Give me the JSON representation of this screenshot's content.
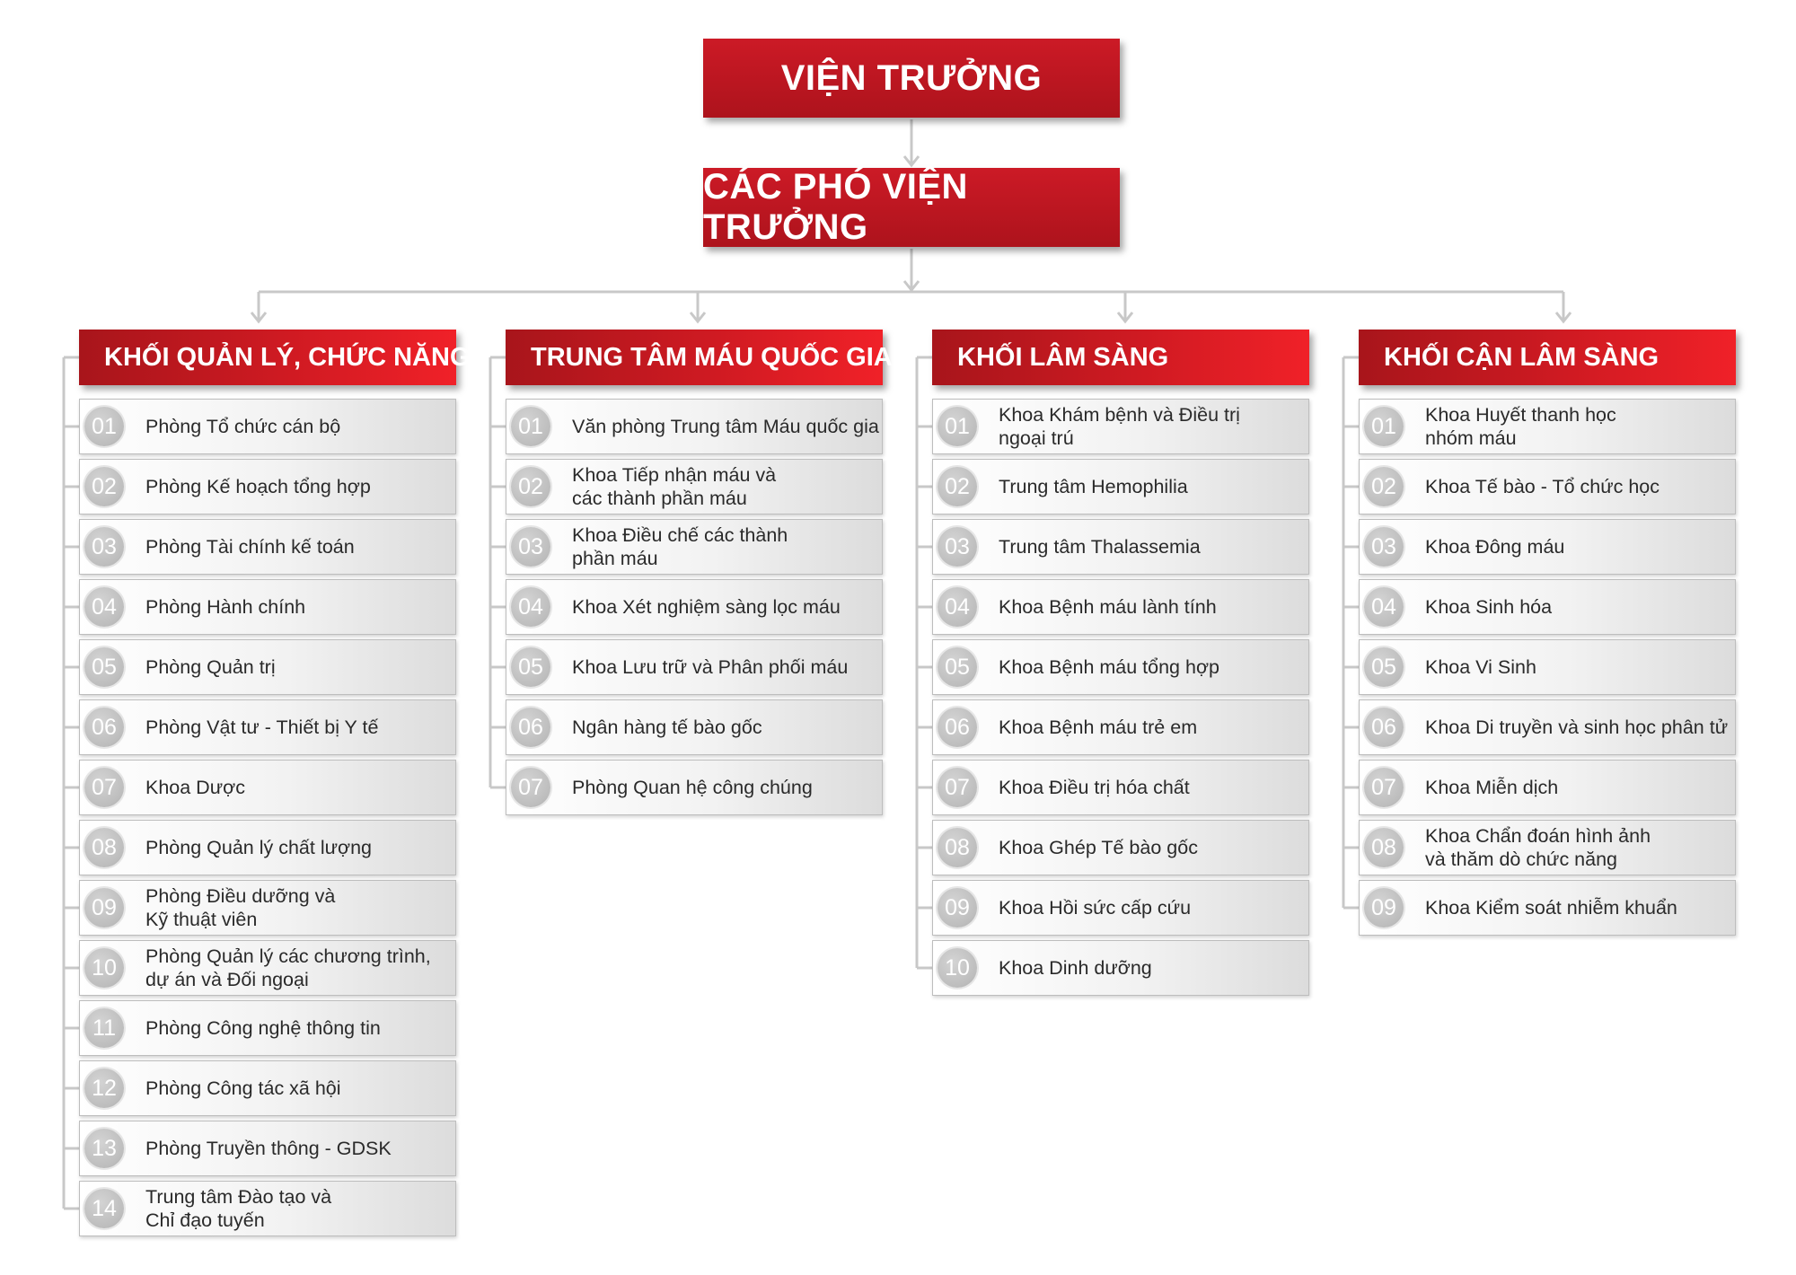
{
  "director": "VIỆN TRƯỞNG",
  "deputy_directors": "CÁC PHÓ VIỆN TRƯỞNG",
  "columns": [
    {
      "title": "KHỐI QUẢN LÝ, CHỨC NĂNG",
      "items": [
        {
          "num": "01",
          "label": "Phòng Tổ chức cán bộ"
        },
        {
          "num": "02",
          "label": "Phòng Kế hoạch tổng hợp"
        },
        {
          "num": "03",
          "label": "Phòng Tài chính kế toán"
        },
        {
          "num": "04",
          "label": "Phòng Hành chính"
        },
        {
          "num": "05",
          "label": "Phòng Quản trị"
        },
        {
          "num": "06",
          "label": "Phòng Vật tư - Thiết bị Y tế"
        },
        {
          "num": "07",
          "label": "Khoa Dược"
        },
        {
          "num": "08",
          "label": "Phòng Quản lý chất lượng"
        },
        {
          "num": "09",
          "label": "Phòng Điều dưỡng và\nKỹ thuật viên"
        },
        {
          "num": "10",
          "label": "Phòng Quản lý các chương trình,\ndự án và Đối ngoại"
        },
        {
          "num": "11",
          "label": "Phòng Công nghệ thông tin"
        },
        {
          "num": "12",
          "label": "Phòng Công tác xã hội"
        },
        {
          "num": "13",
          "label": "Phòng Truyền thông - GDSK"
        },
        {
          "num": "14",
          "label": "Trung tâm Đào tạo và\nChỉ đạo tuyến"
        }
      ]
    },
    {
      "title": "TRUNG TÂM MÁU QUỐC GIA",
      "items": [
        {
          "num": "01",
          "label": "Văn phòng Trung tâm Máu quốc gia"
        },
        {
          "num": "02",
          "label": "Khoa Tiếp nhận máu và\ncác thành phần máu"
        },
        {
          "num": "03",
          "label": "Khoa Điều chế các thành\nphần máu"
        },
        {
          "num": "04",
          "label": "Khoa Xét nghiệm sàng lọc máu"
        },
        {
          "num": "05",
          "label": "Khoa Lưu trữ và Phân phối máu"
        },
        {
          "num": "06",
          "label": "Ngân hàng tế bào gốc"
        },
        {
          "num": "07",
          "label": "Phòng Quan hệ công chúng"
        }
      ]
    },
    {
      "title": "KHỐI LÂM SÀNG",
      "items": [
        {
          "num": "01",
          "label": "Khoa Khám bệnh và Điều trị\nngoại trú"
        },
        {
          "num": "02",
          "label": "Trung tâm Hemophilia"
        },
        {
          "num": "03",
          "label": "Trung tâm Thalassemia"
        },
        {
          "num": "04",
          "label": "Khoa Bệnh máu lành tính"
        },
        {
          "num": "05",
          "label": "Khoa Bệnh máu tổng hợp"
        },
        {
          "num": "06",
          "label": "Khoa Bệnh máu trẻ em"
        },
        {
          "num": "07",
          "label": "Khoa Điều trị hóa chất"
        },
        {
          "num": "08",
          "label": "Khoa Ghép Tế bào gốc"
        },
        {
          "num": "09",
          "label": "Khoa Hồi sức cấp cứu"
        },
        {
          "num": "10",
          "label": "Khoa Dinh dưỡng"
        }
      ]
    },
    {
      "title": "KHỐI CẬN LÂM SÀNG",
      "items": [
        {
          "num": "01",
          "label": "Khoa Huyết thanh học\nnhóm máu"
        },
        {
          "num": "02",
          "label": "Khoa Tế bào - Tổ chức học"
        },
        {
          "num": "03",
          "label": "Khoa Đông máu"
        },
        {
          "num": "04",
          "label": "Khoa Sinh hóa"
        },
        {
          "num": "05",
          "label": "Khoa Vi Sinh"
        },
        {
          "num": "06",
          "label": "Khoa Di truyền và sinh học phân tử"
        },
        {
          "num": "07",
          "label": "Khoa Miễn dịch"
        },
        {
          "num": "08",
          "label": "Khoa Chẩn đoán hình ảnh\nvà thăm dò chức năng"
        },
        {
          "num": "09",
          "label": "Khoa Kiểm soát nhiễm khuẩn"
        }
      ]
    }
  ]
}
